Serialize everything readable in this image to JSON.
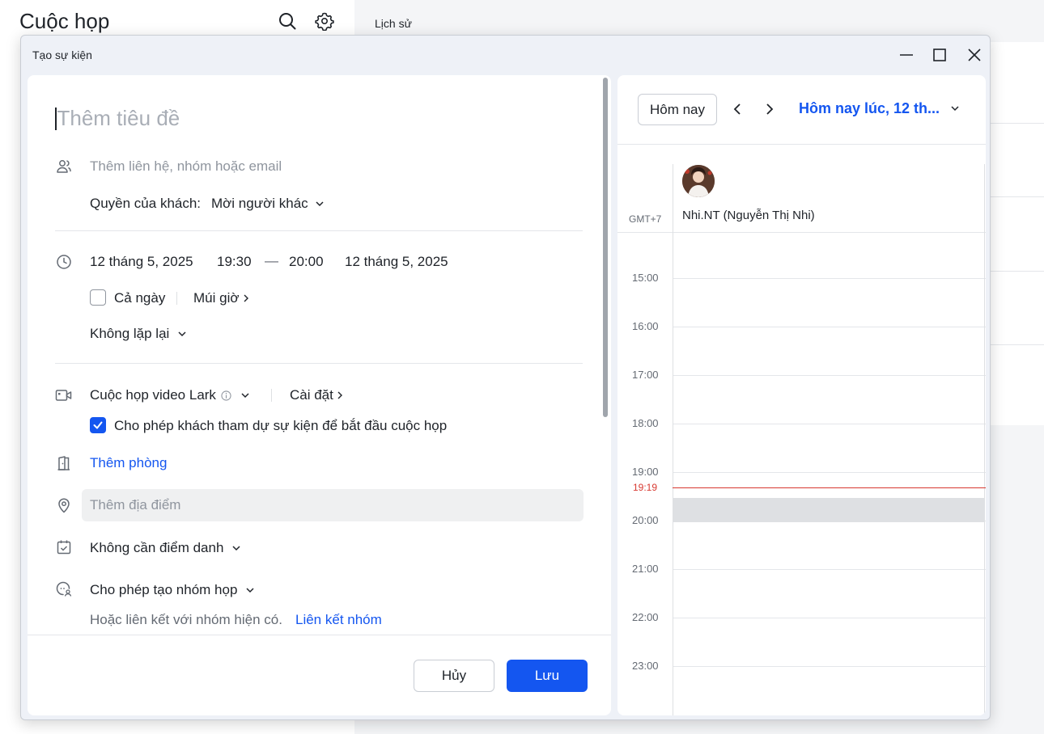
{
  "background": {
    "app_title": "Cuộc họp",
    "history_label": "Lịch sử"
  },
  "dialog": {
    "title": "Tạo sự kiện"
  },
  "form": {
    "title_placeholder": "Thêm tiêu đề",
    "guests_placeholder": "Thêm liên hệ, nhóm hoặc email",
    "guest_permission_label": "Quyền của khách:",
    "guest_permission_value": "Mời người khác",
    "start_date": "12 tháng 5, 2025",
    "start_time": "19:30",
    "dash": "—",
    "end_time": "20:00",
    "end_date": "12 tháng 5, 2025",
    "all_day_label": "Cả ngày",
    "all_day_checked": false,
    "timezone_label": "Múi giờ",
    "repeat_label": "Không lặp lại",
    "video_meeting_label": "Cuộc họp video Lark",
    "settings_label": "Cài đặt",
    "allow_start_label": "Cho phép khách tham dự sự kiện để bắt đầu cuộc họp",
    "allow_start_checked": true,
    "add_room_label": "Thêm phòng",
    "location_placeholder": "Thêm địa điểm",
    "attendance_label": "Không cần điểm danh",
    "group_chat_label": "Cho phép tạo nhóm họp",
    "link_group_text": "Hoặc liên kết với nhóm hiện có.",
    "link_group_link": "Liên kết nhóm",
    "cancel_label": "Hủy",
    "save_label": "Lưu"
  },
  "calendar": {
    "today_button": "Hôm nay",
    "date_title": "Hôm nay lúc, 12 th...",
    "timezone": "GMT+7",
    "person_name": "Nhi.NT (Nguyễn Thị Nhi)",
    "hours": [
      "15:00",
      "16:00",
      "17:00",
      "18:00",
      "19:00",
      "20:00",
      "21:00",
      "22:00",
      "23:00"
    ],
    "current_time": "19:19"
  },
  "colors": {
    "accent": "#1456f0",
    "now_line": "#d83931"
  }
}
